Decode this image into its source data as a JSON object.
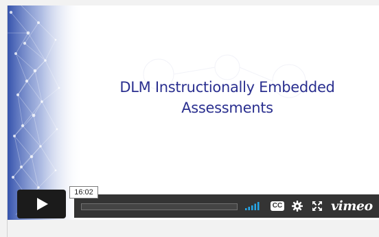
{
  "slide": {
    "title_line1": "DLM Instructionally Embedded",
    "title_line2": "Assessments"
  },
  "player": {
    "time_tooltip": "16:02",
    "brand": "vimeo",
    "play_icon": "play-icon",
    "icons": [
      "volume-bars-icon",
      "closed-captions-icon",
      "gear-icon",
      "fullscreen-icon"
    ],
    "cc_label": "CC"
  },
  "colors": {
    "title": "#2a2f8f",
    "volume": "#1aa3e8",
    "control_bar": "#2a2a2a",
    "play_button": "#1b1b1b"
  }
}
